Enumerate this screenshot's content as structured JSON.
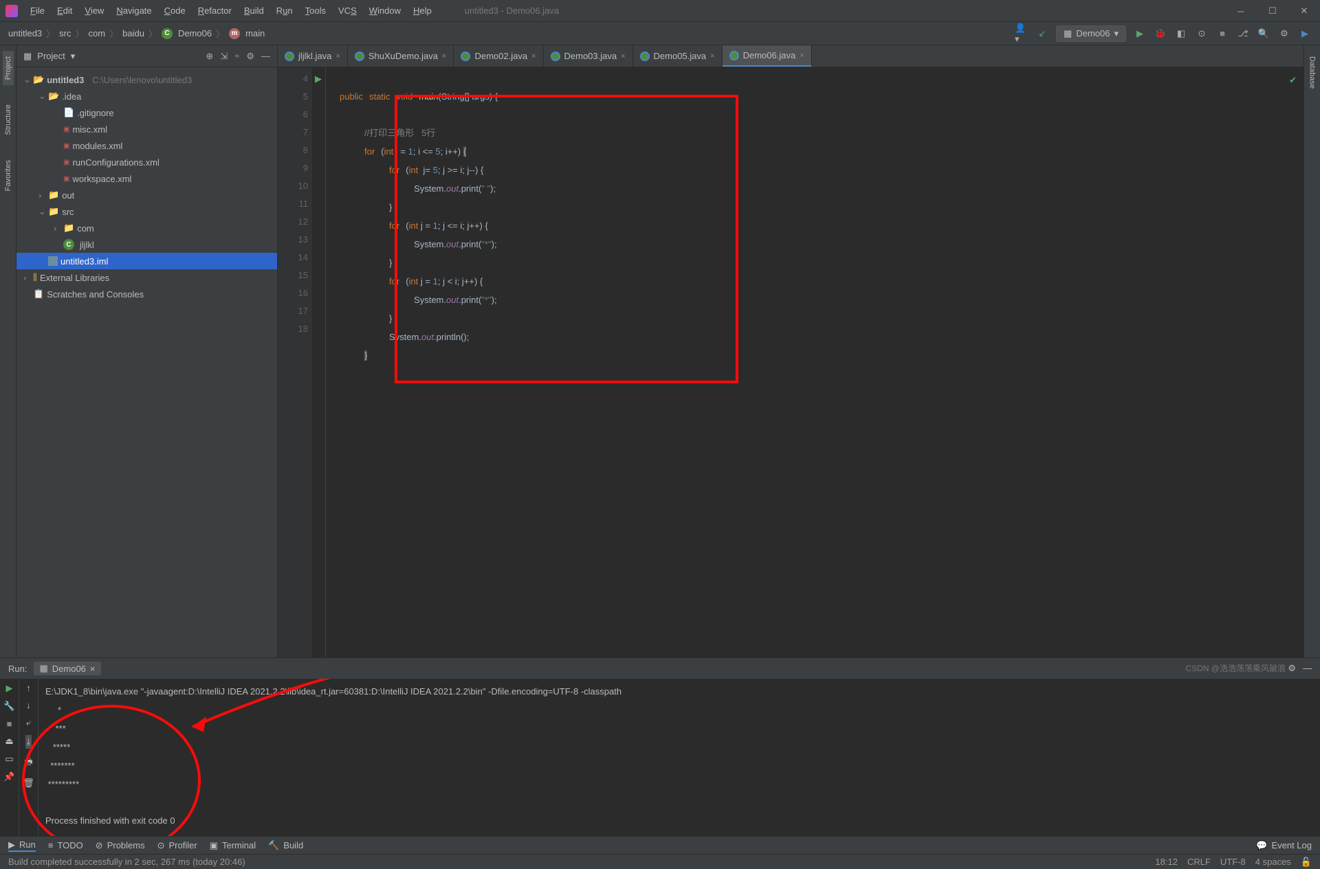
{
  "window_title": "untitled3 - Demo06.java",
  "menu": [
    "File",
    "Edit",
    "View",
    "Navigate",
    "Code",
    "Refactor",
    "Build",
    "Run",
    "Tools",
    "VCS",
    "Window",
    "Help"
  ],
  "breadcrumb": [
    "untitled3",
    "src",
    "com",
    "baidu",
    "Demo06",
    "main"
  ],
  "run_config": "Demo06",
  "panel": {
    "title": "Project"
  },
  "tree": {
    "root": "untitled3",
    "root_path": "C:\\Users\\lenovo\\untitled3",
    "idea": ".idea",
    "files": [
      ".gitignore",
      "misc.xml",
      "modules.xml",
      "runConfigurations.xml",
      "workspace.xml"
    ],
    "out": "out",
    "src": "src",
    "com": "com",
    "jljlkl": "jljlkl",
    "iml": "untitled3.iml",
    "external": "External Libraries",
    "scratch": "Scratches and Consoles"
  },
  "tabs": [
    {
      "label": "jljlkl.java"
    },
    {
      "label": "ShuXuDemo.java"
    },
    {
      "label": "Demo02.java"
    },
    {
      "label": "Demo03.java"
    },
    {
      "label": "Demo05.java"
    },
    {
      "label": "Demo06.java",
      "active": true
    }
  ],
  "gutter": [
    "4",
    "5",
    "6",
    "7",
    "8",
    "9",
    "10",
    "11",
    "12",
    "13",
    "14",
    "15",
    "16",
    "17",
    "18"
  ],
  "code": {
    "l4a": "public",
    "l4b": "static",
    "l4c": "void",
    "l4d": "main",
    "l4e": "(String[] args) {",
    "l6": "//打印三角形   5行",
    "l7a": "for",
    "l7b": "(",
    "l7c": "int",
    "l7d": " i = ",
    "l7e": "1",
    "l7f": "; i <= ",
    "l7g": "5",
    "l7h": "; i++) ",
    "l7i": "{",
    "l8a": "for",
    "l8b": "(",
    "l8c": "int",
    "l8d": "  j= ",
    "l8e": "5",
    "l8f": "; j >= i; j--) {",
    "l9a": "System.",
    "l9b": "out",
    "l9c": ".print(",
    "l9d": "\" \"",
    "l9e": ");",
    "l10": "}",
    "l11a": "for",
    "l11b": "(",
    "l11c": "int",
    "l11d": " j = ",
    "l11e": "1",
    "l11f": "; j <= i; j++) {",
    "l12a": "System.",
    "l12b": "out",
    "l12c": ".print(",
    "l12d": "\"*\"",
    "l12e": ");",
    "l13": "}",
    "l14a": "for",
    "l14b": "(",
    "l14c": "int",
    "l14d": " j = ",
    "l14e": "1",
    "l14f": "; j < i; j++) {",
    "l15a": "System.",
    "l15b": "out",
    "l15c": ".print(",
    "l15d": "\"*\"",
    "l15e": ");",
    "l16": "}",
    "l17a": "System.",
    "l17b": "out",
    "l17c": ".println();",
    "l18": "}"
  },
  "run_label": "Run:",
  "run_tab": "Demo06",
  "console": {
    "cmd": "E:\\JDK1_8\\bin\\java.exe \"-javaagent:D:\\IntelliJ IDEA 2021.2.2\\lib\\idea_rt.jar=60381:D:\\IntelliJ IDEA 2021.2.2\\bin\" -Dfile.encoding=UTF-8 -classpath",
    "out": "     *\n    ***\n   *****\n  *******\n *********",
    "exit": "Process finished with exit code 0"
  },
  "bottom": {
    "run": "Run",
    "todo": "TODO",
    "problems": "Problems",
    "profiler": "Profiler",
    "terminal": "Terminal",
    "build": "Build",
    "event": "Event Log"
  },
  "status": {
    "build": "Build completed successfully in 2 sec, 267 ms (today 20:46)",
    "pos": "18:12",
    "eol": "CRLF",
    "enc": "UTF-8",
    "indent": "4 spaces"
  },
  "watermark": "CSDN @浩浩荡荡乘风破浪"
}
